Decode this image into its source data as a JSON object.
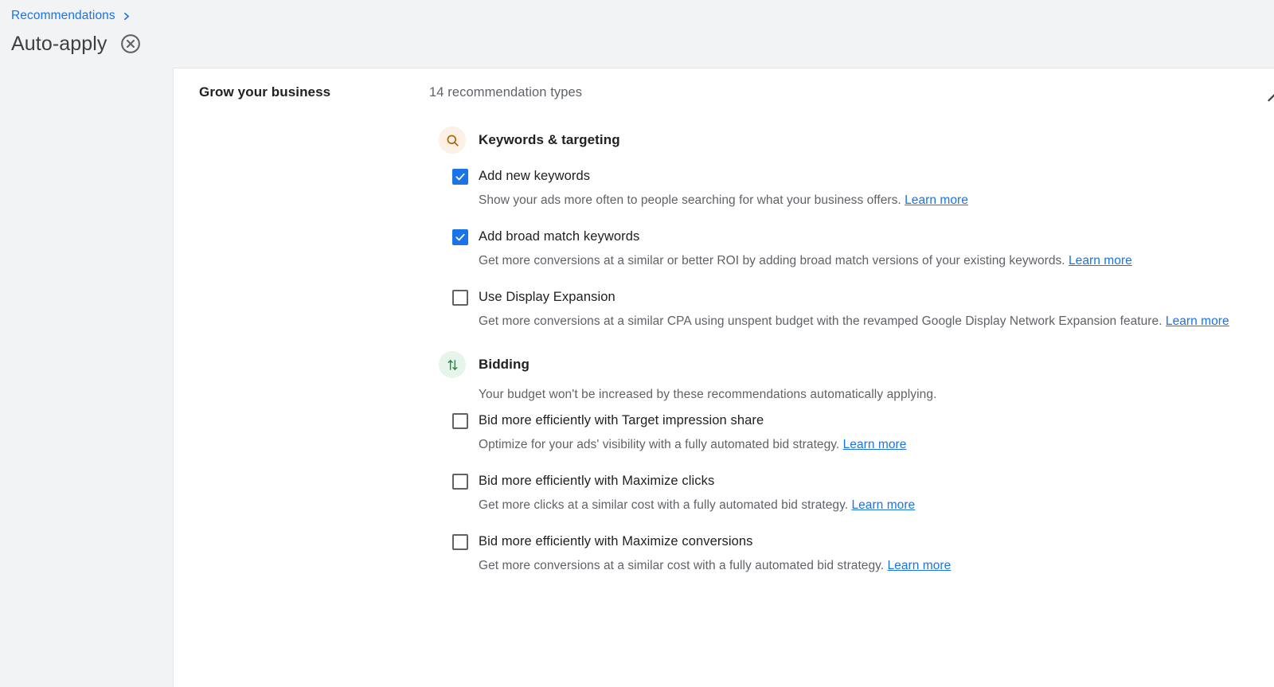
{
  "breadcrumb": {
    "parent_label": "Recommendations",
    "chevron_icon": "chevron-right-icon",
    "page_title": "Auto-apply",
    "close_icon": "close-circle-icon"
  },
  "card": {
    "section_title": "Grow your business",
    "section_count": "14 recommendation types",
    "collapse_icon": "chevron-up-icon",
    "groups": [
      {
        "name": "Keywords & targeting",
        "icon": "search-icon",
        "icon_color": "#b06000",
        "icon_bg": "#fdf0e4",
        "note": "",
        "options": [
          {
            "label": "Add new keywords",
            "checked": true,
            "desc": "Show your ads more often to people searching for what your business offers.",
            "link": "Learn more"
          },
          {
            "label": "Add broad match keywords",
            "checked": true,
            "desc": "Get more conversions at a similar or better ROI by adding broad match versions of your existing keywords.",
            "link": "Learn more"
          },
          {
            "label": "Use Display Expansion",
            "checked": false,
            "desc": "Get more conversions at a similar CPA using unspent budget with the revamped Google Display Network Expansion feature.",
            "link": "Learn more"
          }
        ]
      },
      {
        "name": "Bidding",
        "icon": "arrows-up-down-icon",
        "icon_color": "#1e8e3e",
        "icon_bg": "#e6f4ea",
        "note": "Your budget won't be increased by these recommendations automatically applying.",
        "options": [
          {
            "label": "Bid more efficiently with Target impression share",
            "checked": false,
            "desc": "Optimize for your ads' visibility with a fully automated bid strategy.",
            "link": "Learn more"
          },
          {
            "label": "Bid more efficiently with Maximize clicks",
            "checked": false,
            "desc": "Get more clicks at a similar cost with a fully automated bid strategy.",
            "link": "Learn more"
          },
          {
            "label": "Bid more efficiently with Maximize conversions",
            "checked": false,
            "desc": "Get more conversions at a similar cost with a fully automated bid strategy.",
            "link": "Learn more"
          }
        ]
      }
    ]
  },
  "colors": {
    "accent_blue": "#1a73e8",
    "rail_gray": "#f1f3f4",
    "text_primary": "#202124",
    "text_secondary": "#5f6368"
  }
}
